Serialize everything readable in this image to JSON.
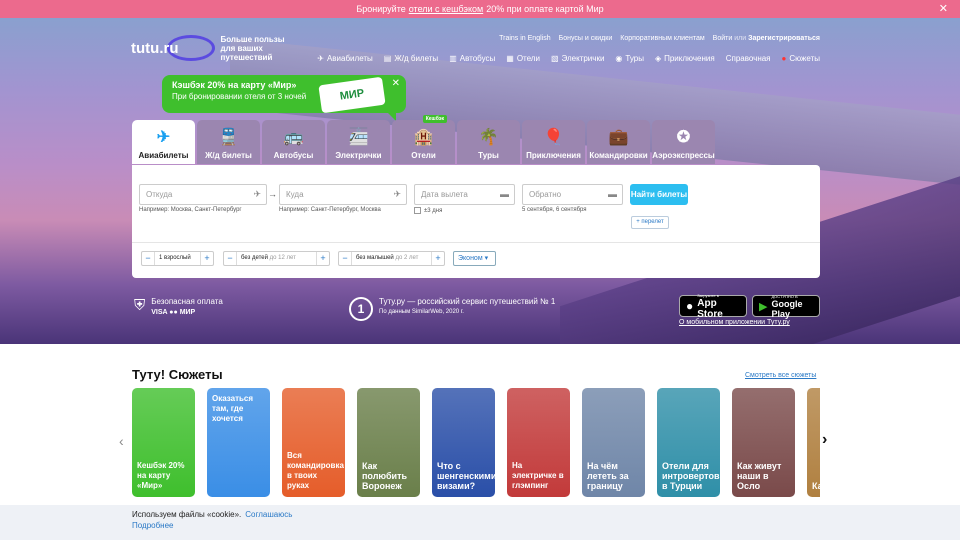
{
  "topbar": {
    "pre": "Бронируйте",
    "link": "отели с кешбэком",
    "post": "20% при оплате картой Мир",
    "close": "✕"
  },
  "header": {
    "logo": "tutu.ru",
    "slogan": "Больше пользы для ваших путешествий",
    "links": {
      "trains": "Trains in English",
      "bonus": "Бонусы и скидки",
      "corp": "Корпоративным клиентам",
      "login": "Войти",
      "or": "или",
      "register": "Зарегистрироваться"
    },
    "nav": [
      {
        "icon": "✈",
        "label": "Авиабилеты"
      },
      {
        "icon": "▤",
        "label": "Ж/д билеты"
      },
      {
        "icon": "▥",
        "label": "Автобусы"
      },
      {
        "icon": "▦",
        "label": "Отели"
      },
      {
        "icon": "▧",
        "label": "Электрички"
      },
      {
        "icon": "◉",
        "label": "Туры"
      },
      {
        "icon": "◈",
        "label": "Приключения"
      },
      {
        "icon": "",
        "label": "Справочная"
      },
      {
        "icon": "●",
        "label": "Сюжеты"
      }
    ]
  },
  "promo": {
    "title": "Кэшбэк 20% на карту «Мир»",
    "subtitle": "При бронировании отеля от 3 ночей",
    "card": "МИР",
    "close": "✕"
  },
  "tabs": [
    {
      "icon": "✈",
      "label": "Авиабилеты"
    },
    {
      "icon": "🚆",
      "label": "Ж/д билеты"
    },
    {
      "icon": "🚌",
      "label": "Автобусы"
    },
    {
      "icon": "🚈",
      "label": "Электрички"
    },
    {
      "icon": "🏨",
      "label": "Отели",
      "badge": "Кешбэк"
    },
    {
      "icon": "🌴",
      "label": "Туры"
    },
    {
      "icon": "🎈",
      "label": "Приключения"
    },
    {
      "icon": "💼",
      "label": "Командировки"
    },
    {
      "icon": "✪",
      "label": "Аэроэкспрессы"
    }
  ],
  "search": {
    "from": {
      "placeholder": "Откуда",
      "hint": "Например: Москва, Санкт-Петербург"
    },
    "to": {
      "placeholder": "Куда",
      "hint": "Например: Санкт-Петербург, Москва"
    },
    "date": {
      "placeholder": "Дата вылета",
      "flex": "±3 дня"
    },
    "back": {
      "placeholder": "Обратно",
      "hint": "5 сентября, 6 сентября"
    },
    "find": "Найти билеты",
    "add_flight": "+ перелет",
    "adults": "1 взрослый",
    "children": "без детей",
    "children_sub": "до 12 лет",
    "infants": "без малышей",
    "infants_sub": "до 2 лет",
    "class": "Эконом ▾"
  },
  "trust": {
    "secure_title": "Безопасная оплата",
    "secure_methods": "VISA  ●●  МИР",
    "award_num": "1",
    "award_title": "Туту.ру — российский сервис путешествий № 1",
    "award_sub": "По данным SimilarWeb, 2020 г.",
    "appstore_small": "Загрузите в",
    "appstore": "App Store",
    "gplay_small": "ДОСТУПНО В",
    "gplay": "Google Play",
    "mobile_app": "О мобильном приложении Туту.ру"
  },
  "stories": {
    "title": "Туту! Сюжеты",
    "all": "Смотреть все сюжеты",
    "items": [
      {
        "text": "Кешбэк 20% на карту «Мир»",
        "pos": "bottom",
        "color": "#3fbf2d"
      },
      {
        "text": "Оказаться там, где хочется",
        "pos": "top",
        "color": "#3a8ee6"
      },
      {
        "text": "Вся командировка в твоих руках",
        "pos": "bottom",
        "color": "#e55d2a"
      },
      {
        "text": "Как полюбить Воронеж",
        "pos": "bottom",
        "color": "#6a7f4a"
      },
      {
        "text": "Что с шенгенскими визами?",
        "pos": "bottom",
        "color": "#2a4fa8"
      },
      {
        "text": "На электричке в глэмпинг",
        "pos": "bottom",
        "color": "#c23a3a"
      },
      {
        "text": "На чём лететь за границу",
        "pos": "bottom",
        "color": "#6f86a8"
      },
      {
        "text": "Отели для интровертов в Турции",
        "pos": "bottom",
        "color": "#2f8fa8"
      },
      {
        "text": "Как живут наши в Осло",
        "pos": "bottom",
        "color": "#7a4a4a"
      },
      {
        "text": "Как б...",
        "pos": "bottom",
        "color": "#b08040"
      }
    ]
  },
  "cookie": {
    "text": "Используем файлы «cookie».",
    "agree": "Соглашаюсь",
    "more": "Подробнее"
  }
}
